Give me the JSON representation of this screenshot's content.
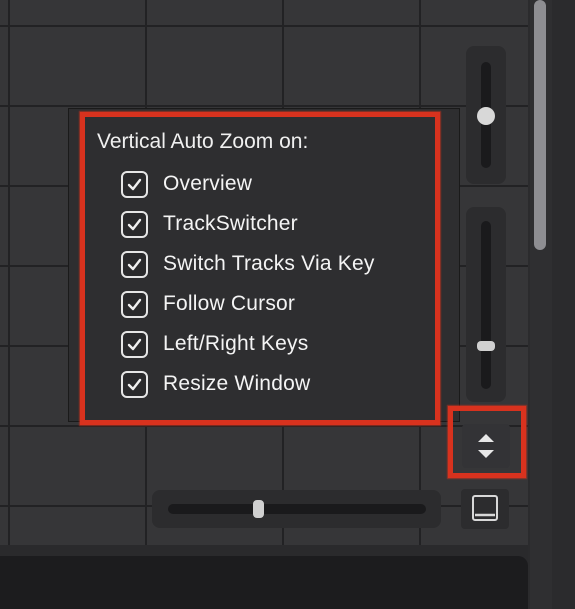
{
  "popup": {
    "title": "Vertical Auto Zoom on:",
    "options": [
      {
        "label": "Overview",
        "checked": true
      },
      {
        "label": "TrackSwitcher",
        "checked": true
      },
      {
        "label": "Switch Tracks Via Key",
        "checked": true
      },
      {
        "label": "Follow Cursor",
        "checked": true
      },
      {
        "label": "Left/Right Keys",
        "checked": true
      },
      {
        "label": "Resize Window",
        "checked": true
      }
    ]
  },
  "controls": {
    "top_slider_level": 0.55,
    "bottom_slider_level": 0.3,
    "horizontal_slider_level": 0.35
  },
  "icons": {
    "zoom_button": "up-down-arrows-icon",
    "window_button": "minimize-window-icon",
    "check": "checkmark-icon"
  },
  "colors": {
    "highlight": "#d8321e",
    "background": "#363638",
    "popup": "#2e2e30"
  }
}
